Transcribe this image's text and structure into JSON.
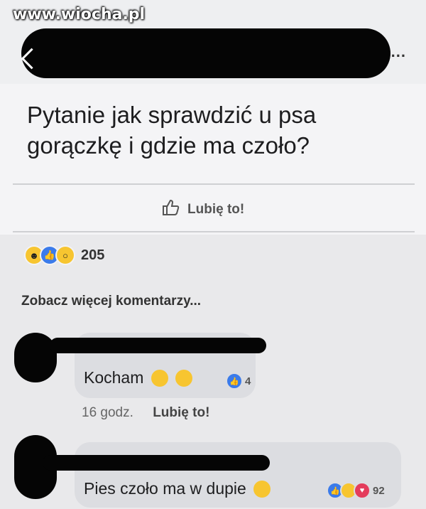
{
  "watermark": "www.wiocha.pl",
  "header": {
    "more_label": "..."
  },
  "post": {
    "text": "Pytanie jak sprawdzić u psa gorączkę i gdzie ma czoło?",
    "like_label": "Lubię to!",
    "reaction_count": "205",
    "reaction_icons": [
      "haha-icon",
      "like-icon",
      "wow-icon"
    ]
  },
  "comments_link": "Zobacz więcej komentarzy...",
  "comments": [
    {
      "text": "Kocham",
      "reaction_count": "4",
      "time": "16 godz.",
      "like_label": "Lubię to!"
    },
    {
      "text": "Pies czoło ma w dupie",
      "reaction_count": "92"
    }
  ],
  "colors": {
    "like_blue": "#3b7bea",
    "haha_yellow": "#f7c530",
    "love_red": "#e43c5c"
  }
}
